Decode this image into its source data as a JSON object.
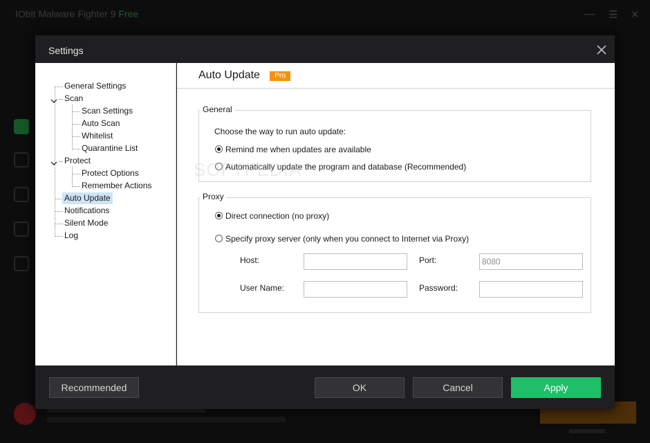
{
  "background_app": {
    "title": "IObit Malware Fighter 9",
    "title_tag": "Free"
  },
  "dialog": {
    "title": "Settings"
  },
  "tree": {
    "items": [
      {
        "label": "General Settings"
      },
      {
        "label": "Scan"
      },
      {
        "label": "Scan Settings"
      },
      {
        "label": "Auto Scan"
      },
      {
        "label": "Whitelist"
      },
      {
        "label": "Quarantine List"
      },
      {
        "label": "Protect"
      },
      {
        "label": "Protect Options"
      },
      {
        "label": "Remember Actions"
      },
      {
        "label": "Auto Update"
      },
      {
        "label": "Notifications"
      },
      {
        "label": "Silent Mode"
      },
      {
        "label": "Log"
      }
    ],
    "selected": "Auto Update"
  },
  "content": {
    "heading": "Auto Update",
    "badge": "Pro",
    "general": {
      "title": "General",
      "prompt": "Choose the way to run auto update:",
      "options": [
        {
          "label": "Remind me when updates are available",
          "checked": true
        },
        {
          "label": "Automatically update the program and database (Recommended)",
          "checked": false
        }
      ]
    },
    "proxy": {
      "title": "Proxy",
      "options": [
        {
          "label": "Direct connection (no proxy)",
          "checked": true
        },
        {
          "label": "Specify proxy server (only when you connect to Internet via Proxy)",
          "checked": false
        }
      ],
      "host_label": "Host:",
      "host_value": "",
      "port_label": "Port:",
      "port_value": "8080",
      "username_label": "User Name:",
      "username_value": "",
      "password_label": "Password:",
      "password_value": ""
    }
  },
  "footer": {
    "recommended_label": "Recommended",
    "ok_label": "OK",
    "cancel_label": "Cancel",
    "apply_label": "Apply"
  },
  "watermark": "SOFTPEDIA",
  "colors": {
    "accent_green": "#1fbf68",
    "pro_orange": "#f29410",
    "dialog_bg": "#1f1f21",
    "selection": "#cce4f7"
  },
  "icons": [
    "close-icon",
    "collapse-icon"
  ]
}
